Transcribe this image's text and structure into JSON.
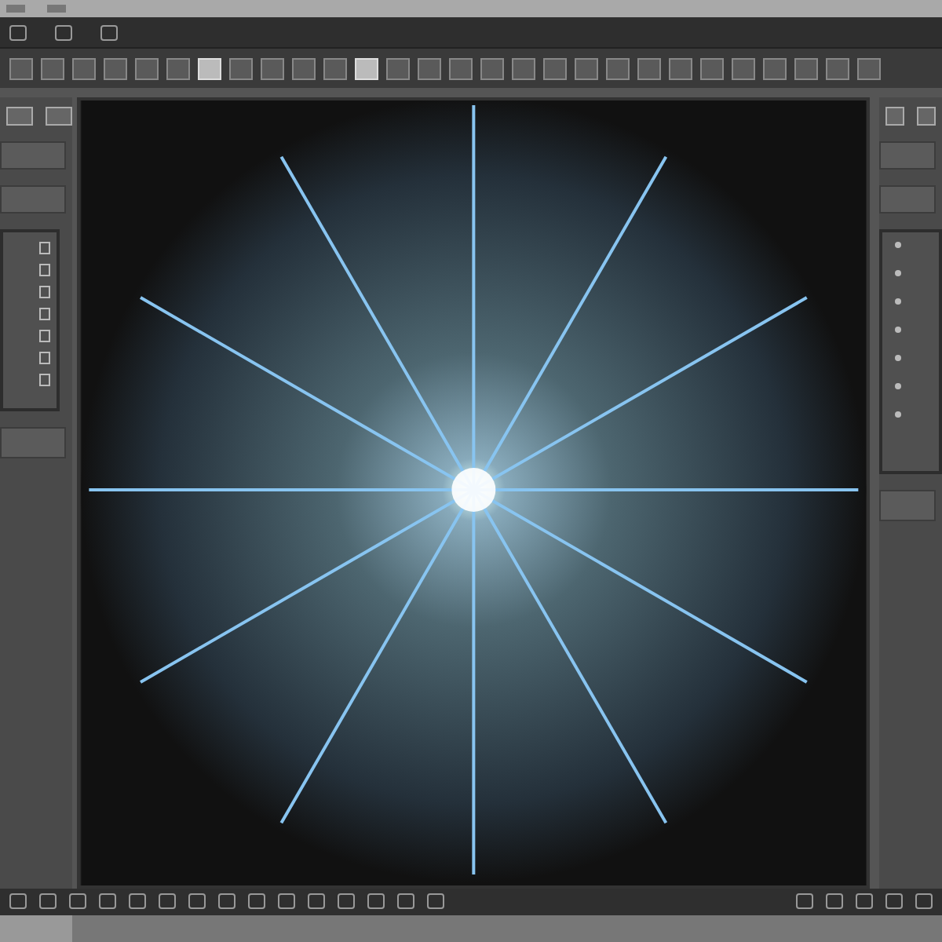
{
  "toolbar": {
    "tools": [
      {
        "selected": false
      },
      {
        "selected": false
      },
      {
        "selected": false
      },
      {
        "selected": false
      },
      {
        "selected": false
      },
      {
        "selected": false
      },
      {
        "selected": true
      },
      {
        "selected": false
      },
      {
        "selected": false
      },
      {
        "selected": false
      },
      {
        "selected": false
      },
      {
        "selected": true
      },
      {
        "selected": false
      },
      {
        "selected": false
      },
      {
        "selected": false
      },
      {
        "selected": false
      },
      {
        "selected": false
      },
      {
        "selected": false
      },
      {
        "selected": false
      },
      {
        "selected": false
      },
      {
        "selected": false
      },
      {
        "selected": false
      },
      {
        "selected": false
      },
      {
        "selected": false
      },
      {
        "selected": false
      },
      {
        "selected": false
      },
      {
        "selected": false
      },
      {
        "selected": false
      }
    ]
  }
}
